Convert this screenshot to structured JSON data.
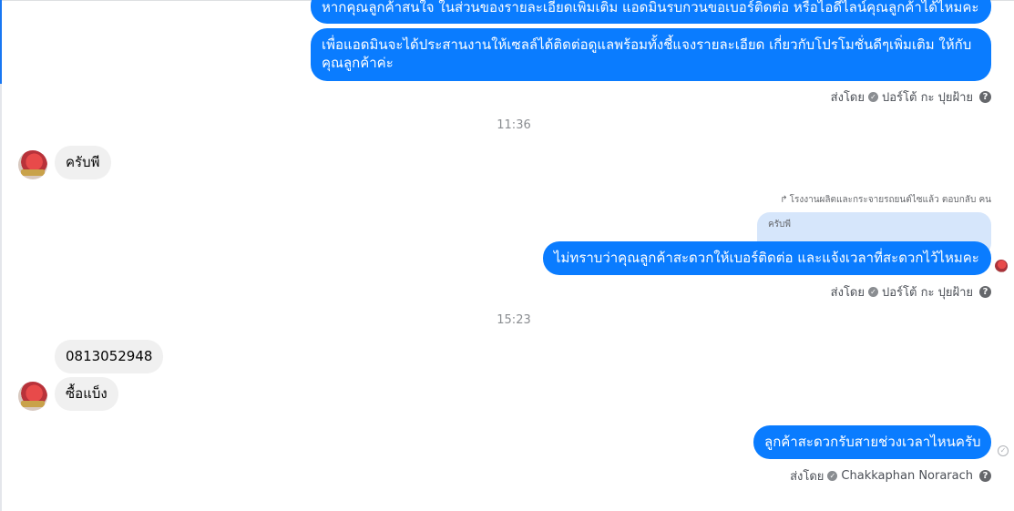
{
  "messages": {
    "out1_line1": "หากคุณลูกค้าสนใจ ในส่วนของรายละเอียดเพิ่มเติม แอดมินรบกวนขอเบอร์ติดต่อ หรือไอดีไลน์คุณลูกค้าได้ไหมคะ",
    "out2": "เพื่อแอดมินจะได้ประสานงานให้เซลล์ได้ติดต่อดูแลพร้อมทั้งชี้แจงรายละเอียด เกี่ยวกับโปรโมชั่นดีๆเพิ่มเติม ให้กับคุณลูกค้าค่ะ",
    "time1": "11:36",
    "in1": "ครับพี",
    "reply_note": "โรงงานผลิตและกระจายรถยนต์ไซแล้ว ตอบกลับ คน",
    "quoted": "ครับพี",
    "out3": "ไม่ทราบว่าคุณลูกค้าสะดวกให้เบอร์ติดต่อ และแจ้งเวลาที่สะดวกไว้ไหมคะ",
    "time2": "15:23",
    "in2": "0813052948",
    "in3": "ซื้อแบ็ง",
    "out4": "ลูกค้าสะดวกรับสายช่วงเวลาไหนครับ"
  },
  "sent_by": {
    "label": "ส่งโดย",
    "name1": "ปอร์โต้ กะ ปุยฝ้าย",
    "name2": "ปอร์โต้ กะ ปุยฝ้าย",
    "name3": "Chakkaphan Norarach",
    "help_glyph": "?"
  },
  "icons": {
    "check_glyph": "✓",
    "reply_glyph": "↱"
  }
}
